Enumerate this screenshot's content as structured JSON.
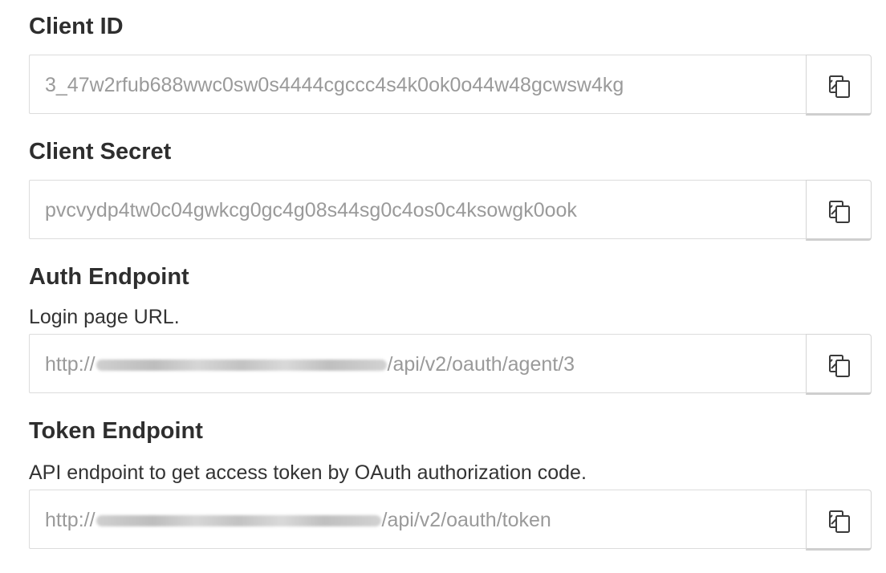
{
  "fields": [
    {
      "label": "Client ID",
      "description": "",
      "value": "3_47w2rfub688wwc0sw0s4444cgccc4s4k0ok0o44w48gcwsw4kg",
      "copy_icon": "copy-icon"
    },
    {
      "label": "Client Secret",
      "description": "",
      "value": "pvcvydp4tw0c04gwkcg0gc4g08s44sg0c4os0c4ksowgk0ook",
      "copy_icon": "copy-icon"
    },
    {
      "label": "Auth Endpoint",
      "description": "Login page URL.",
      "value_prefix": "http://",
      "value_suffix": "/api/v2/oauth/agent/3",
      "copy_icon": "copy-icon"
    },
    {
      "label": "Token Endpoint",
      "description": "API endpoint to get access token by OAuth authorization code.",
      "value_prefix": "http://",
      "value_suffix": "/api/v2/oauth/token",
      "copy_icon": "copy-icon"
    }
  ]
}
